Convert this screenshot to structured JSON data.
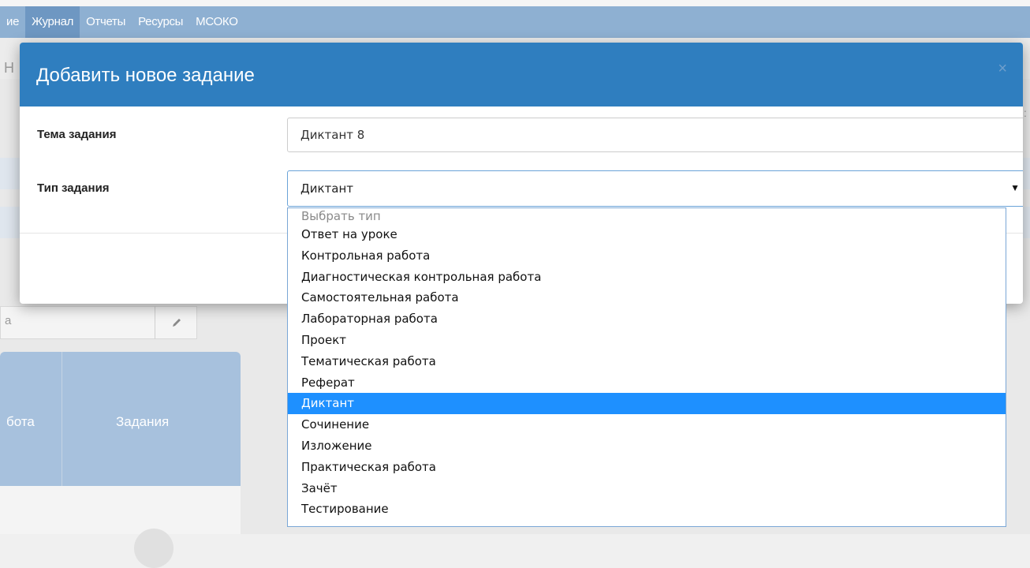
{
  "nav": {
    "items": [
      "ие",
      "Журнал",
      "Отчеты",
      "Ресурсы",
      "МСОКО"
    ],
    "active_index": 1
  },
  "background": {
    "header_fragment": "Н",
    "input_fragment": "а",
    "table_headers": [
      "бота",
      "Задания"
    ]
  },
  "modal": {
    "title": "Добавить новое задание",
    "close_label": "×",
    "fields": {
      "topic_label": "Тема задания",
      "topic_value": "Диктант 8",
      "type_label": "Тип задания",
      "type_value": "Диктант"
    }
  },
  "dropdown": {
    "placeholder": "Выбрать тип",
    "options": [
      "Ответ на уроке",
      "Контрольная работа",
      "Диагностическая контрольная работа",
      "Самостоятельная работа",
      "Лабораторная работа",
      "Проект",
      "Тематическая работа",
      "Реферат",
      "Диктант",
      "Сочинение",
      "Изложение",
      "Практическая работа",
      "Зачёт",
      "Тестирование"
    ],
    "selected": "Диктант"
  },
  "colors": {
    "navbar": "#8eb0d2",
    "modal_header": "#2f7ebf",
    "selected_option": "#1e90ff"
  }
}
